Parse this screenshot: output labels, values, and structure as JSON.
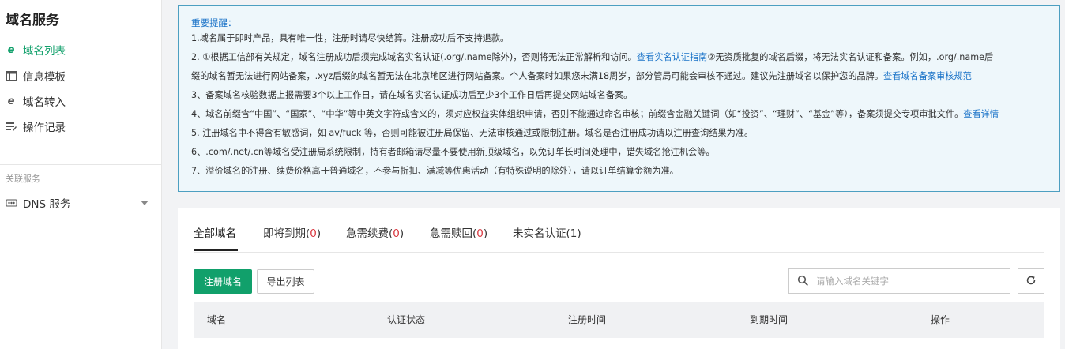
{
  "sidebar": {
    "title": "域名服务",
    "items": [
      {
        "label": "域名列表",
        "icon": "ie-e-icon"
      },
      {
        "label": "信息模板",
        "icon": "table-icon"
      },
      {
        "label": "域名转入",
        "icon": "ie-e-icon"
      },
      {
        "label": "操作记录",
        "icon": "edit-list-icon"
      }
    ],
    "section_label": "关联服务",
    "related": [
      {
        "label": "DNS 服务",
        "icon": "dns-icon"
      }
    ]
  },
  "notice": {
    "title": "重要提醒：",
    "line1": "1.域名属于即时产品，具有唯一性，注册时请尽快结算。注册成功后不支持退款。",
    "line2a": "2. ①根据工信部有关规定，域名注册成功后须完成域名实名认证(.org/.name除外)，否则将无法正常解析和访问。",
    "line2_link1": "查看实名认证指南",
    "line2b": "②无资质批复的域名后缀，将无法实名认证和备案。例如，.org/.name后",
    "line2c": "缀的域名暂无法进行网站备案，.xyz后缀的域名暂无法在北京地区进行网站备案。个人备案时如果您未满18周岁，部分管局可能会审核不通过。建议先注册域名以保护您的品牌。",
    "line2_link2": "查看域名备案审核规范",
    "line3": "3、备案域名核验数据上报需要3个以上工作日，请在域名实名认证成功后至少3个工作日后再提交网站域名备案。",
    "line4a": "4、域名前缀含“中国”、“国家”、“中华”等中英文字符或含义的，须对应权益实体组织申请，否则不能通过命名审核；前缀含金融关键词（如“投资”、“理财”、“基金”等），备案须提交专项审批文件。",
    "line4_link": "查看详情",
    "line5": "5. 注册域名中不得含有敏感词，如 av/fuck 等，否则可能被注册局保留、无法审核通过或限制注册。域名是否注册成功请以注册查询结果为准。",
    "line6": "6、.com/.net/.cn等域名受注册局系统限制，持有者邮箱请尽量不要使用新顶级域名，以免订单长时间处理中，错失域名抢注机会等。",
    "line7": "7、溢价域名的注册、续费价格高于普通域名，不参与折扣、满减等优惠活动（有特殊说明的除外），请以订单结算金额为准。"
  },
  "tabs": [
    {
      "label": "全部域名",
      "count": ""
    },
    {
      "label": "即将到期",
      "count": "0"
    },
    {
      "label": "急需续费",
      "count": "0"
    },
    {
      "label": "急需赎回",
      "count": "0"
    },
    {
      "label": "未实名认证",
      "count": "1"
    }
  ],
  "toolbar": {
    "register_label": "注册域名",
    "export_label": "导出列表",
    "search_placeholder": "请输入域名关键字"
  },
  "table": {
    "columns": [
      "域名",
      "认证状态",
      "注册时间",
      "到期时间",
      "操作"
    ]
  },
  "colors": {
    "accent": "#11a06b",
    "link": "#1a73c8",
    "count": "#d9363e"
  }
}
